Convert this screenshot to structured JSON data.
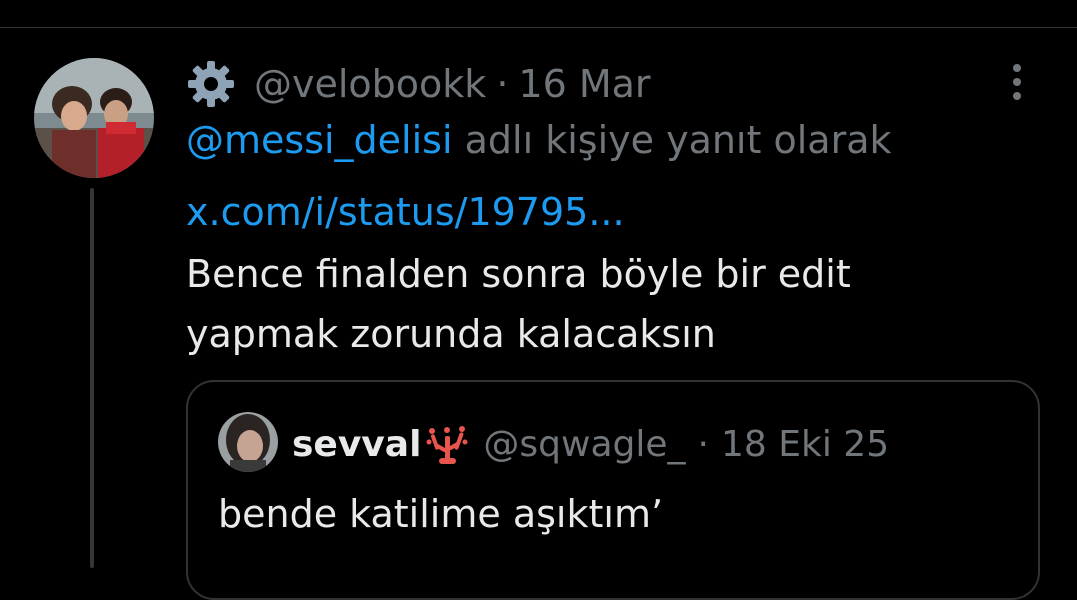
{
  "tweet": {
    "handle": "@velobookk",
    "separator": "·",
    "date": "16 Mar",
    "reply_to_mention": "@messi_delisi",
    "reply_to_suffix": " adlı kişiye yanıt olarak",
    "link_text": "x.com/i/status/19795...",
    "body_line_1": "Bence finalden sonra böyle bir edit",
    "body_line_2": "yapmak zorunda kalacaksın",
    "author_icon": "gear-icon",
    "more_icon": "more-vertical-icon"
  },
  "quote": {
    "display_name": "sevval",
    "name_emoji": "coral-icon",
    "handle": "@sqwagle_",
    "separator": "·",
    "date": "18 Eki 25",
    "text": "bende katilime aşıktım’"
  },
  "colors": {
    "background": "#000000",
    "text_primary": "#e7e9ea",
    "text_secondary": "#71767b",
    "link": "#1d9bf0",
    "border": "#2f3336"
  }
}
